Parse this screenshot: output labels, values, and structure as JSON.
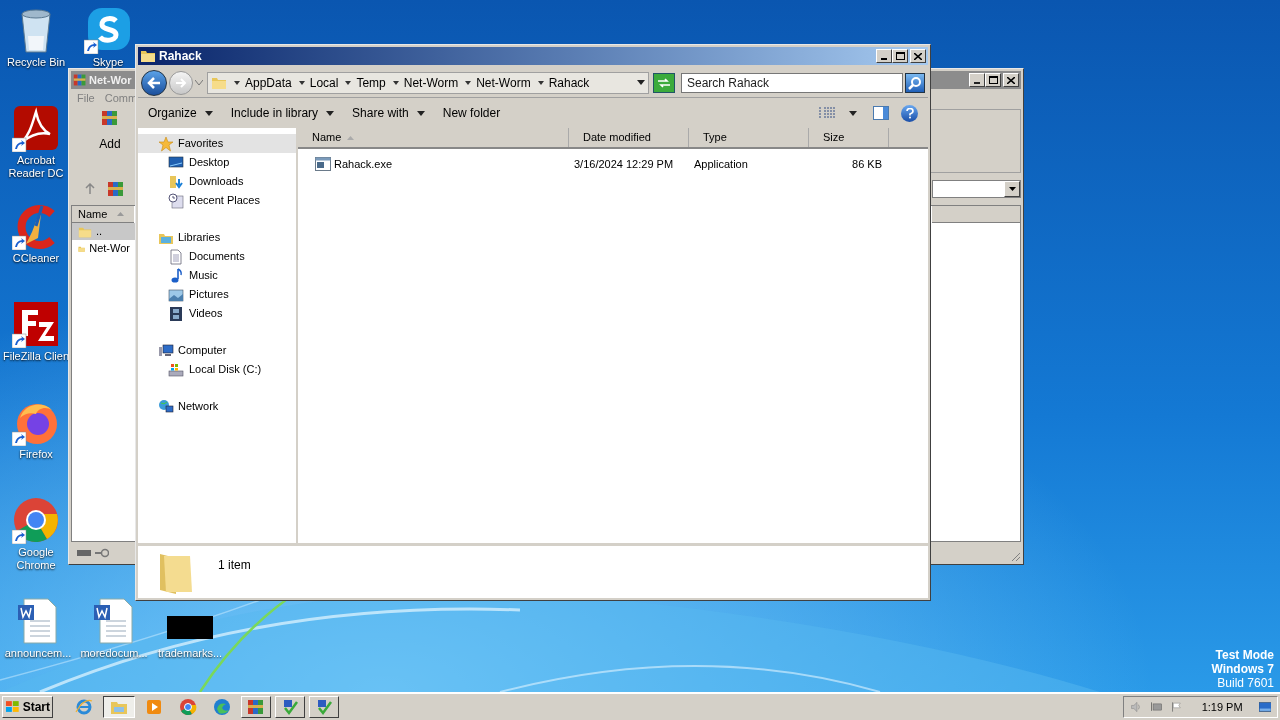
{
  "desktop": {
    "column_icons": [
      {
        "label": "Recycle Bin",
        "kind": "recycle"
      },
      {
        "label": "Acrobat Reader DC",
        "kind": "acrobat"
      },
      {
        "label": "CCleaner",
        "kind": "ccleaner"
      },
      {
        "label": "FileZilla Clien",
        "kind": "filezilla"
      },
      {
        "label": "Firefox",
        "kind": "firefox"
      },
      {
        "label": "Google Chrome",
        "kind": "chrome"
      }
    ],
    "top_icons": [
      {
        "label": "Skype",
        "kind": "skype"
      }
    ],
    "bottom_icons": [
      {
        "label": "announcem...",
        "kind": "word"
      },
      {
        "label": "moredocum...",
        "kind": "word"
      },
      {
        "label": "trademarks...",
        "kind": "blank"
      }
    ],
    "notice": [
      "Test Mode",
      "Windows 7",
      "Build 7601"
    ]
  },
  "archiver_window": {
    "title": "Net-Wor",
    "menu": [
      "File",
      "Comm"
    ],
    "toolbar": [
      {
        "label": "Add"
      }
    ],
    "column": "Name",
    "rows": [
      {
        "name": "..",
        "selected": true
      },
      {
        "name": "Net-Wor",
        "selected": false
      }
    ]
  },
  "explorer": {
    "title": "Rahack",
    "breadcrumb": [
      "AppData",
      "Local",
      "Temp",
      "Net-Worm",
      "Net-Worm",
      "Rahack"
    ],
    "search": {
      "placeholder": "Search Rahack"
    },
    "toolbar": [
      {
        "label": "Organize",
        "dropdown": true
      },
      {
        "label": "Include in library",
        "dropdown": true
      },
      {
        "label": "Share with",
        "dropdown": true
      },
      {
        "label": "New folder",
        "dropdown": false
      }
    ],
    "nav": [
      {
        "label": "Favorites",
        "kind": "favorites",
        "selected": true,
        "children": [
          {
            "label": "Desktop",
            "kind": "desktop",
            "selected": false
          },
          {
            "label": "Downloads",
            "kind": "downloads",
            "selected": false
          },
          {
            "label": "Recent Places",
            "kind": "recent",
            "selected": false
          }
        ]
      },
      {
        "label": "Libraries",
        "kind": "libraries",
        "selected": false,
        "children": [
          {
            "label": "Documents",
            "kind": "documents",
            "selected": false
          },
          {
            "label": "Music",
            "kind": "music",
            "selected": false
          },
          {
            "label": "Pictures",
            "kind": "pictures",
            "selected": false
          },
          {
            "label": "Videos",
            "kind": "videos",
            "selected": false
          }
        ]
      },
      {
        "label": "Computer",
        "kind": "computer",
        "selected": false,
        "children": [
          {
            "label": "Local Disk (C:)",
            "kind": "disk",
            "selected": false
          }
        ]
      },
      {
        "label": "Network",
        "kind": "network",
        "selected": false
      }
    ],
    "columns": [
      {
        "label": "Name",
        "sorted": true
      },
      {
        "label": "Date modified",
        "sorted": false
      },
      {
        "label": "Type",
        "sorted": false
      },
      {
        "label": "Size",
        "sorted": false
      }
    ],
    "rows": [
      {
        "cells": [
          "Rahack.exe",
          "3/16/2024 12:29 PM",
          "Application",
          "86 KB"
        ]
      }
    ],
    "status": "1 item"
  },
  "taskbar": {
    "start": "Start",
    "apps": [
      {
        "kind": "ie",
        "active": false
      },
      {
        "kind": "explorer",
        "active": true
      },
      {
        "kind": "media",
        "active": false
      },
      {
        "kind": "chrome",
        "active": false
      },
      {
        "kind": "edge",
        "active": false
      },
      {
        "kind": "archiver",
        "active": false
      },
      {
        "kind": "tool",
        "active": false
      },
      {
        "kind": "tool",
        "active": false
      }
    ],
    "time": "1:19 PM"
  }
}
